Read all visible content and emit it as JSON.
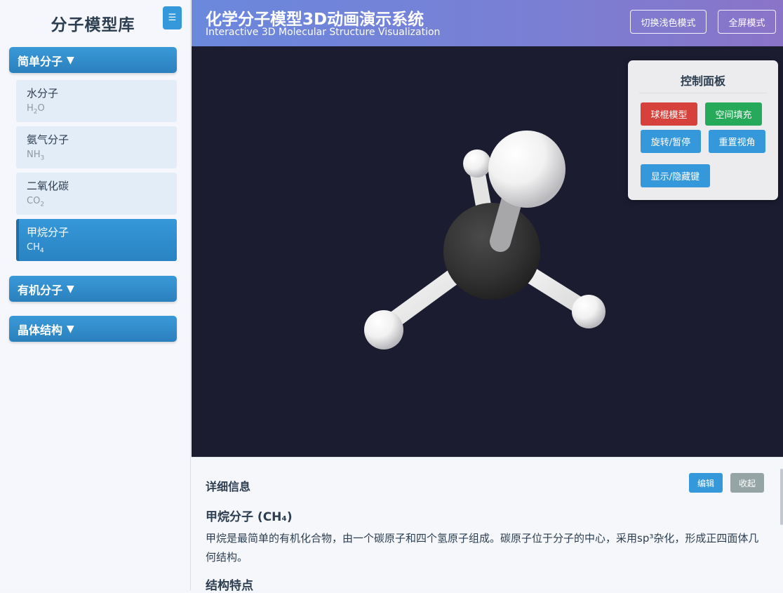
{
  "sidebar": {
    "title": "分子模型库",
    "toggle_icon": "☰",
    "categories": [
      {
        "label": "简单分子",
        "arrow": "▼",
        "items": [
          {
            "name": "水分子",
            "formula_base": "H",
            "formula_sub": "2",
            "formula_rest": "O"
          },
          {
            "name": "氨气分子",
            "formula_base": "NH",
            "formula_sub": "3",
            "formula_rest": ""
          },
          {
            "name": "二氧化碳",
            "formula_base": "CO",
            "formula_sub": "2",
            "formula_rest": ""
          },
          {
            "name": "甲烷分子",
            "formula_base": "CH",
            "formula_sub": "4",
            "formula_rest": ""
          }
        ]
      },
      {
        "label": "有机分子",
        "arrow": "▼"
      },
      {
        "label": "晶体结构",
        "arrow": "▼"
      }
    ]
  },
  "header": {
    "title": "化学分子模型3D动画演示系统",
    "subtitle": "Interactive 3D Molecular Structure Visualization",
    "light_mode_button": "切换浅色模式",
    "fullscreen_button": "全屏模式"
  },
  "control_panel": {
    "title": "控制面板",
    "buttons": {
      "ball_stick": "球棍模型",
      "space_fill": "空间填充",
      "rotate_pause": "旋转/暂停",
      "reset_view": "重置视角",
      "toggle_bonds": "显示/隐藏键"
    }
  },
  "details": {
    "heading": "详细信息",
    "edit_button": "编辑",
    "collapse_button": "收起",
    "molecule_title": "甲烷分子 (CH₄)",
    "description": "甲烷是最简单的有机化合物，由一个碳原子和四个氢原子组成。碳原子位于分子的中心，采用sp³杂化，形成正四面体几何结构。",
    "section_title": "结构特点"
  },
  "colors": {
    "accent_blue": "#3498db",
    "active_red": "#d6413b",
    "green": "#27a95a",
    "gray": "#95a5a6",
    "viewer_bg": "#1b1c30"
  }
}
